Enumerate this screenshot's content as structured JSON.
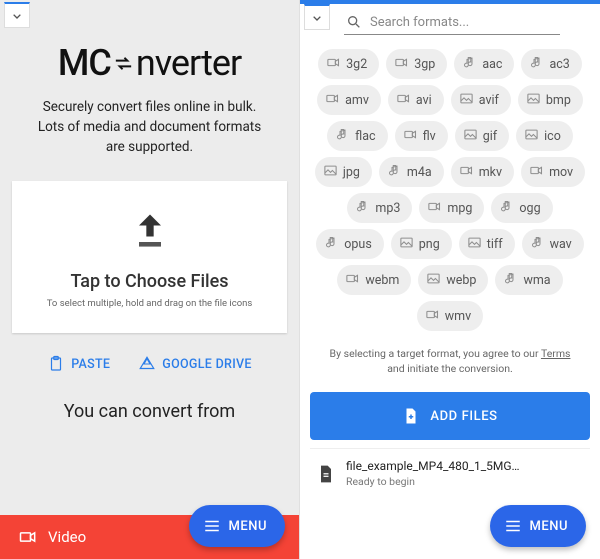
{
  "left": {
    "logo_part1": "MC",
    "logo_part2": "nverter",
    "tagline": "Securely convert files online in bulk. Lots of media and document formats are supported.",
    "dropzone_title": "Tap to Choose Files",
    "dropzone_subtitle": "To select multiple, hold and drag on the file icons",
    "paste_label": "PASTE",
    "gdrive_label": "GOOGLE DRIVE",
    "convert_from_heading": "You can convert from",
    "video_tab": "Video",
    "menu_label": "MENU"
  },
  "right": {
    "search_placeholder": "Search formats...",
    "formats": [
      {
        "icon": "video",
        "label": "3g2"
      },
      {
        "icon": "video",
        "label": "3gp"
      },
      {
        "icon": "audio",
        "label": "aac"
      },
      {
        "icon": "audio",
        "label": "ac3"
      },
      {
        "icon": "video",
        "label": "amv"
      },
      {
        "icon": "video",
        "label": "avi"
      },
      {
        "icon": "image",
        "label": "avif"
      },
      {
        "icon": "image",
        "label": "bmp"
      },
      {
        "icon": "audio",
        "label": "flac"
      },
      {
        "icon": "video",
        "label": "flv"
      },
      {
        "icon": "image",
        "label": "gif"
      },
      {
        "icon": "image",
        "label": "ico"
      },
      {
        "icon": "image",
        "label": "jpg"
      },
      {
        "icon": "audio",
        "label": "m4a"
      },
      {
        "icon": "video",
        "label": "mkv"
      },
      {
        "icon": "video",
        "label": "mov"
      },
      {
        "icon": "audio",
        "label": "mp3"
      },
      {
        "icon": "video",
        "label": "mpg"
      },
      {
        "icon": "audio",
        "label": "ogg"
      },
      {
        "icon": "audio",
        "label": "opus"
      },
      {
        "icon": "image",
        "label": "png"
      },
      {
        "icon": "image",
        "label": "tiff"
      },
      {
        "icon": "audio",
        "label": "wav"
      },
      {
        "icon": "video",
        "label": "webm"
      },
      {
        "icon": "image",
        "label": "webp"
      },
      {
        "icon": "audio",
        "label": "wma"
      },
      {
        "icon": "video",
        "label": "wmv"
      }
    ],
    "terms_prefix": "By selecting a target format, you agree to our ",
    "terms_link": "Terms",
    "terms_suffix": " and initiate the conversion.",
    "add_files": "ADD FILES",
    "file_name": "file_example_MP4_480_1_5MG…",
    "file_status": "Ready to begin",
    "menu_label": "MENU"
  }
}
